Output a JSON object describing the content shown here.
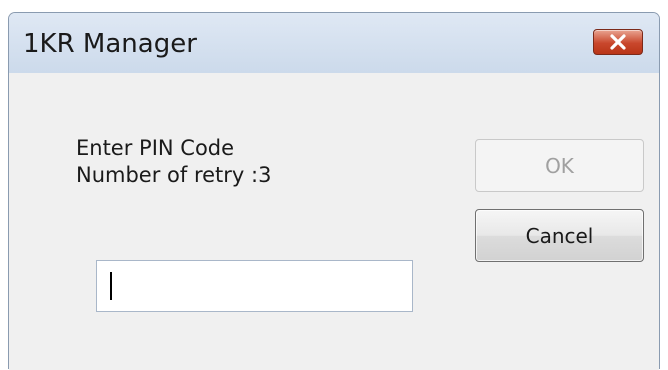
{
  "window": {
    "title": "1KR Manager"
  },
  "prompt": {
    "line1": "Enter PIN Code",
    "line2": "Number of retry :3"
  },
  "pin_input": {
    "value": "",
    "placeholder": ""
  },
  "buttons": {
    "ok_label": "OK",
    "ok_enabled": false,
    "cancel_label": "Cancel"
  },
  "icons": {
    "close": "close-icon"
  },
  "colors": {
    "close_button": "#c9472c",
    "title_bar": "#d5e1ef",
    "client_background": "#f0f0f0"
  }
}
